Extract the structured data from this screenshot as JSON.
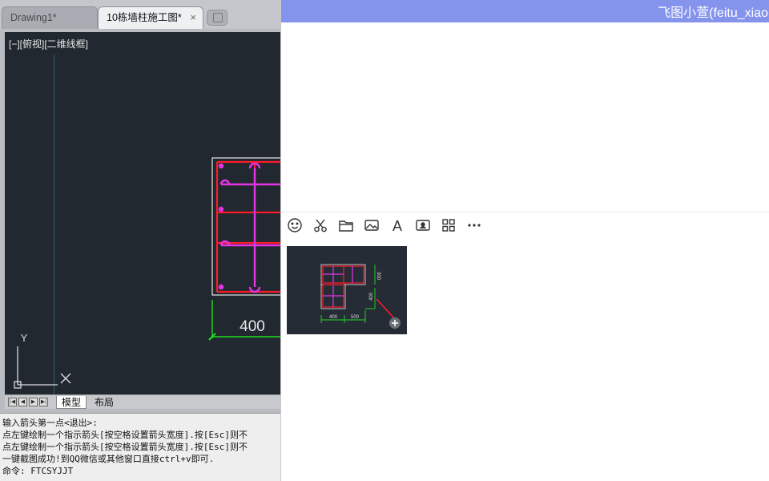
{
  "cad": {
    "tabs": [
      {
        "label": "Drawing1*"
      },
      {
        "label": "10栋墙柱施工图*",
        "close": "×"
      }
    ],
    "view_label": "[−][俯视][二维线框]",
    "dimension_label": "400",
    "ucs": {
      "x_label": "X",
      "y_label": "Y"
    },
    "layout_tabs": [
      {
        "label": "模型"
      },
      {
        "label": "布局"
      }
    ],
    "nav_buttons": [
      "|◀",
      "◀",
      "▶",
      "▶|"
    ],
    "command_lines": [
      "输入箭头第一点<退出>:",
      "点左键绘制一个指示箭头[按空格设置箭头宽度].按[Esc]则不",
      "点左键绘制一个指示箭头[按空格设置箭头宽度].按[Esc]则不",
      "一键截图成功!到QQ微信或其他窗口直接ctrl+v即可.",
      "命令: FTCSYJJT"
    ],
    "colors": {
      "background": "#212830",
      "wall": "#ff1c2a",
      "rebar": "#e534e5",
      "dimension": "#22dd22"
    }
  },
  "chat": {
    "title": "飞图小萱(feitu_xiao",
    "header_color": "#8494ec",
    "toolbar": [
      {
        "icon": "emoji-icon"
      },
      {
        "icon": "scissors-icon"
      },
      {
        "icon": "folder-icon"
      },
      {
        "icon": "image-icon"
      },
      {
        "icon": "font-icon",
        "label": "A"
      },
      {
        "icon": "contact-card-icon"
      },
      {
        "icon": "apps-grid-icon"
      },
      {
        "icon": "more-icon"
      }
    ],
    "pasted_image": {
      "dims": [
        "400",
        "500",
        "300",
        "400"
      ]
    }
  }
}
